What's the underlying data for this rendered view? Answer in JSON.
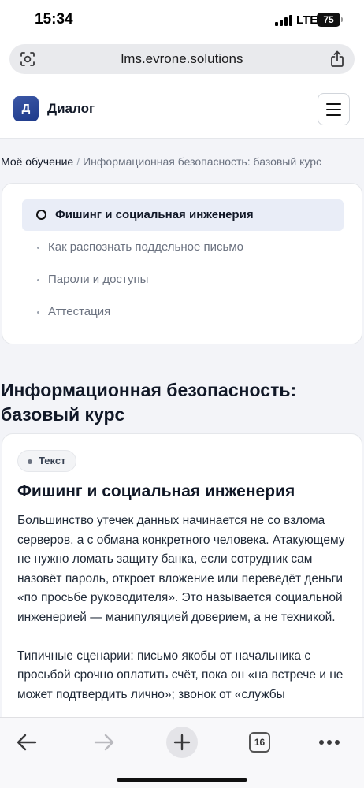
{
  "status_bar": {
    "time": "15:34",
    "network": "LTE",
    "battery": "75",
    "icons": [
      "signal-bars-icon",
      "battery-icon"
    ]
  },
  "browser": {
    "url": "lms.evrone.solutions",
    "tab_count": "16",
    "icons": [
      "reader-icon",
      "share-icon",
      "back-arrow-icon",
      "forward-arrow-icon",
      "new-tab-plus-icon",
      "tabs-icon",
      "more-icon"
    ]
  },
  "header": {
    "logo_letter": "Д",
    "brand": "Диалог",
    "menu_icon": "hamburger-menu-icon"
  },
  "breadcrumb": {
    "parent": "Моё обучение",
    "separator": "/",
    "current": "Информационная безопасность: базовый курс"
  },
  "lesson_nav": {
    "items": [
      {
        "label": "Фишинг и социальная инженерия",
        "active": true
      },
      {
        "label": "Как распознать поддельное письмо",
        "active": false
      },
      {
        "label": "Пароли и доступы",
        "active": false
      },
      {
        "label": "Аттестация",
        "active": false
      }
    ]
  },
  "course": {
    "title": "Информационная безопасность: базовый курс"
  },
  "lesson": {
    "type_badge": "Текст",
    "heading": "Фишинг и социальная инженерия",
    "paragraphs": [
      "Большинство утечек данных начинается не со взлома серверов, а с обмана конкретного человека. Атакующему не нужно ломать защиту банка, если сотрудник сам назовёт пароль, откроет вложение или переведёт деньги «по просьбе руководителя». Это называется социальной инженерией — манипуляцией доверием, а не техникой.",
      "Типичные сценарии: письмо якобы от начальника с просьбой срочно оплатить счёт, пока он «на встрече и не может подтвердить лично»; звонок от «службы"
    ]
  },
  "colors": {
    "page_bg": "#f3f4f8",
    "logo_blue": "#1e3a8a",
    "active_nav_bg": "#e9edf7",
    "text_primary": "#111827",
    "text_muted": "#6b7280"
  }
}
